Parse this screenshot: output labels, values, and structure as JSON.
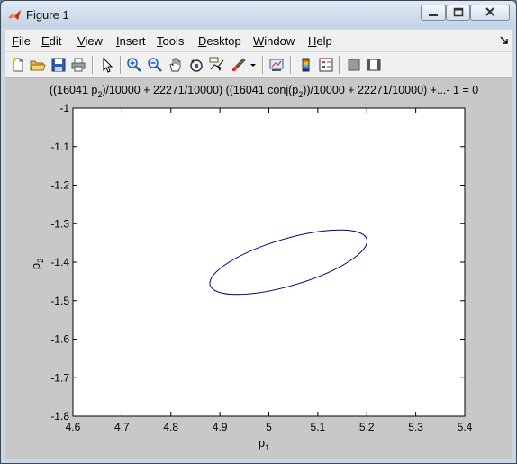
{
  "window": {
    "title": "Figure 1",
    "buttons": [
      "minimize",
      "maximize",
      "close"
    ]
  },
  "menu": [
    {
      "label": "File",
      "key": "F"
    },
    {
      "label": "Edit",
      "key": "E"
    },
    {
      "label": "View",
      "key": "V"
    },
    {
      "label": "Insert",
      "key": "I"
    },
    {
      "label": "Tools",
      "key": "T"
    },
    {
      "label": "Desktop",
      "key": "D"
    },
    {
      "label": "Window",
      "key": "W"
    },
    {
      "label": "Help",
      "key": "H"
    }
  ],
  "toolbar": {
    "tools": [
      "new-figure",
      "open-file",
      "save-figure",
      "print-figure",
      "edit-plot",
      "zoom-in",
      "zoom-out",
      "pan",
      "rotate-3d",
      "data-cursor",
      "brush",
      "link-plot",
      "insert-colorbar",
      "insert-legend",
      "hide-plot-tools",
      "show-plot-tools"
    ]
  },
  "chart_data": {
    "type": "line",
    "title": "((16041 p2)/10000 + 22271/10000) ((16041 conj(p2))/10000 + 22271/10000) +...- 1 = 0",
    "title_parts": {
      "pre": "((16041 p",
      "sub1": "2",
      "mid": ")/10000 + 22271/10000) ((16041 conj(p",
      "sub2": "2",
      "post": "))/10000 + 22271/10000) +...- 1 = 0"
    },
    "xlabel": "p1",
    "xlabel_parts": {
      "base": "p",
      "sub": "1"
    },
    "ylabel": "p2",
    "ylabel_parts": {
      "base": "p",
      "sub": "2"
    },
    "xlim": [
      4.6,
      5.4
    ],
    "ylim": [
      -1.8,
      -1.0
    ],
    "xticks": [
      "4.6",
      "4.7",
      "4.8",
      "4.9",
      "5",
      "5.1",
      "5.2",
      "5.3",
      "5.4"
    ],
    "yticks": [
      "-1",
      "-1.1",
      "-1.2",
      "-1.3",
      "-1.4",
      "-1.5",
      "-1.6",
      "-1.7",
      "-1.8"
    ],
    "grid": false,
    "series": [
      {
        "color": "#00007f",
        "shape": "ellipse",
        "center": [
          5.04,
          -1.4
        ],
        "axis_points": {
          "rightmost": [
            5.2,
            -1.34
          ],
          "topmost": [
            5.11,
            -1.27
          ]
        }
      }
    ]
  }
}
